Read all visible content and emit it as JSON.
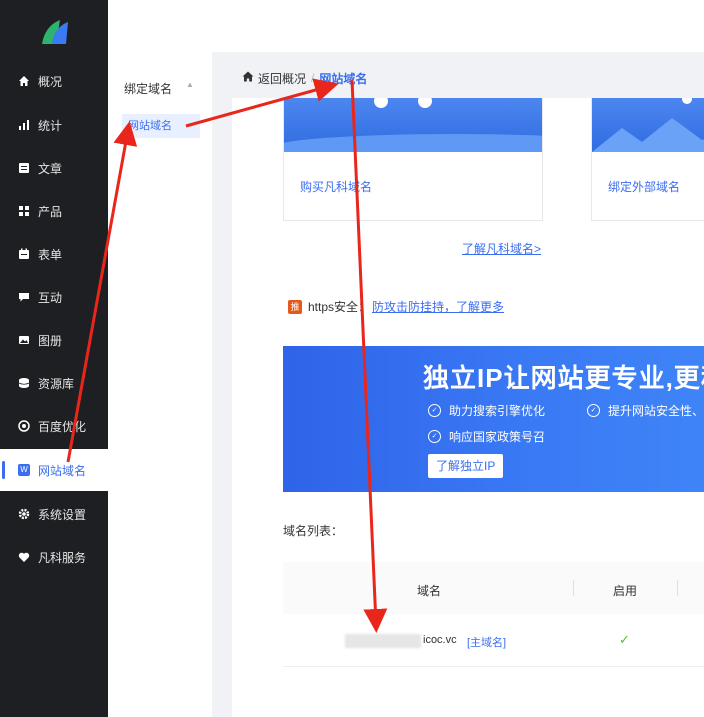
{
  "sidebar": {
    "items": [
      {
        "label": "概况",
        "icon": "home-icon"
      },
      {
        "label": "统计",
        "icon": "stats-icon"
      },
      {
        "label": "文章",
        "icon": "article-icon"
      },
      {
        "label": "产品",
        "icon": "product-icon"
      },
      {
        "label": "表单",
        "icon": "form-icon"
      },
      {
        "label": "互动",
        "icon": "chat-icon"
      },
      {
        "label": "图册",
        "icon": "album-icon"
      },
      {
        "label": "资源库",
        "icon": "database-icon"
      },
      {
        "label": "百度优化",
        "icon": "seo-icon"
      },
      {
        "label": "网站域名",
        "icon": "domain-icon",
        "badge": "W"
      },
      {
        "label": "系统设置",
        "icon": "gear-icon"
      },
      {
        "label": "凡科服务",
        "icon": "heart-icon"
      }
    ]
  },
  "subnav": {
    "group": "绑定域名",
    "item": "网站域名"
  },
  "breadcrumb": {
    "home": "返回概况",
    "separator": "/",
    "current": "网站域名"
  },
  "cards": {
    "buy": "购买凡科域名",
    "bind": "绑定外部域名"
  },
  "learn_more": "了解凡科域名>",
  "https": {
    "badge": "推",
    "text": "https安全：",
    "link": "防攻击防挂持，了解更多"
  },
  "promo": {
    "headline": "独立IP让网站更专业,更稳",
    "features": [
      "助力搜索引擎优化",
      "提升网站安全性、",
      "响应国家政策号召"
    ],
    "button": "了解独立IP"
  },
  "domain_list": {
    "label": "域名列表：",
    "columns": [
      "域名",
      "启用"
    ],
    "rows": [
      {
        "domain_suffix": "icoc.vc",
        "tag": "[主域名]",
        "enabled": "✓"
      }
    ]
  },
  "colors": {
    "accent": "#3a6df0",
    "sidebar_bg": "#1e1f22",
    "annotation_arrow": "#e8261b",
    "check_green": "#52c41a"
  }
}
